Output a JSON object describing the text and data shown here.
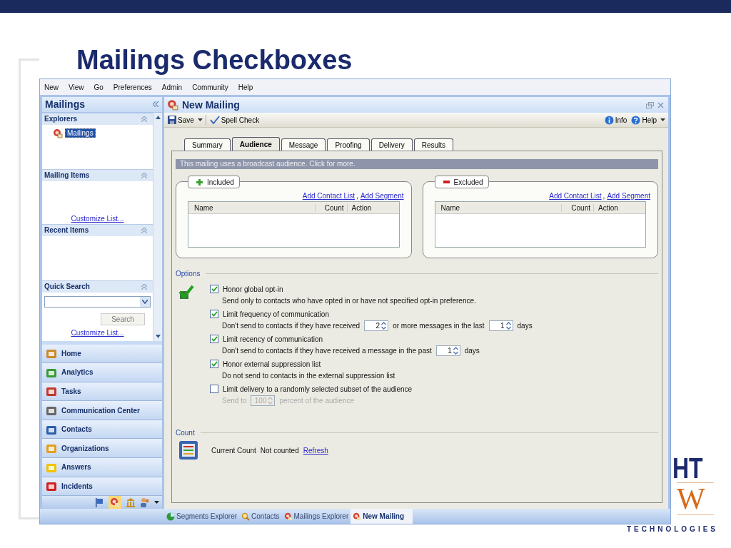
{
  "slide": {
    "title": "Mailings Checkboxes",
    "logo_top": "HT",
    "logo_middle": "W",
    "logo_bottom": "TECHNOLOGIES"
  },
  "menu": [
    "New",
    "View",
    "Go",
    "Preferences",
    "Admin",
    "Community",
    "Help"
  ],
  "sidebar": {
    "title": "Mailings",
    "sections": [
      {
        "title": "Explorers",
        "items": [
          {
            "label": "Mailings",
            "selected": true
          }
        ]
      },
      {
        "title": "Mailing Items",
        "link": "Customize List..."
      },
      {
        "title": "Recent Items"
      },
      {
        "title": "Quick Search",
        "search_button": "Search",
        "link": "Customize List..."
      }
    ],
    "nav": [
      "Home",
      "Analytics",
      "Tasks",
      "Communication Center",
      "Contacts",
      "Organizations",
      "Answers",
      "Incidents"
    ]
  },
  "document": {
    "title": "New Mailing",
    "toolbar": {
      "save": "Save",
      "spell_check": "Spell Check",
      "info": "Info",
      "help": "Help"
    },
    "tabs": [
      {
        "label": "Summary",
        "selected": false
      },
      {
        "label": "Audience",
        "selected": true
      },
      {
        "label": "Message",
        "selected": false
      },
      {
        "label": "Proofing",
        "selected": false
      },
      {
        "label": "Delivery",
        "selected": false
      },
      {
        "label": "Results",
        "selected": false
      }
    ],
    "banner": "This mailing uses a broadcast audience.  Click for more.",
    "groups": [
      {
        "title": "Included",
        "kind": "include",
        "links": [
          "Add Contact List",
          "Add Segment"
        ],
        "link_separator": ",",
        "columns": [
          "Name",
          "Count",
          "Action"
        ]
      },
      {
        "title": "Excluded",
        "kind": "exclude",
        "links": [
          "Add Contact List",
          "Add Segment"
        ],
        "link_separator": ",",
        "columns": [
          "Name",
          "Count",
          "Action"
        ]
      }
    ],
    "options": {
      "title": "Options",
      "items": [
        {
          "label": "Honor global opt-in",
          "checked": true,
          "disabled": false,
          "detail": [
            {
              "kind": "text",
              "text": "Send only to contacts who have opted in or have not specified opt-in preference."
            }
          ]
        },
        {
          "label": "Limit frequency of communication",
          "checked": true,
          "disabled": false,
          "detail": [
            {
              "kind": "text",
              "text": "Don't send to contacts if they have received"
            },
            {
              "kind": "spinner",
              "value": "2"
            },
            {
              "kind": "text",
              "text": "or more messages in the last"
            },
            {
              "kind": "spinner",
              "value": "1"
            },
            {
              "kind": "text",
              "text": "days"
            }
          ]
        },
        {
          "label": "Limit recency of communication",
          "checked": true,
          "disabled": false,
          "detail": [
            {
              "kind": "text",
              "text": "Don't send to contacts if they have received a message in the past"
            },
            {
              "kind": "spinner",
              "value": "1"
            },
            {
              "kind": "text",
              "text": "days"
            }
          ]
        },
        {
          "label": "Honor external suppression list",
          "checked": true,
          "disabled": false,
          "detail": [
            {
              "kind": "text",
              "text": "Do not send to contacts in the external suppression list"
            }
          ]
        },
        {
          "label": "Limit delivery to a randomly selected subset of the audience",
          "checked": false,
          "disabled": true,
          "detail": [
            {
              "kind": "text",
              "text": "Send to"
            },
            {
              "kind": "spinner",
              "value": "100"
            },
            {
              "kind": "text",
              "text": "percent of the audience"
            }
          ]
        }
      ]
    },
    "count": {
      "title": "Count",
      "label": "Current Count",
      "value": "Not counted",
      "link": "Refresh"
    }
  },
  "bottom_tabs": [
    {
      "label": "Segments Explorer",
      "kind": "segments",
      "selected": false
    },
    {
      "label": "Contacts",
      "kind": "contacts",
      "selected": false
    },
    {
      "label": "Mailings Explorer",
      "kind": "mailing",
      "selected": false
    },
    {
      "label": "New Mailing",
      "kind": "mailing",
      "selected": true
    }
  ]
}
